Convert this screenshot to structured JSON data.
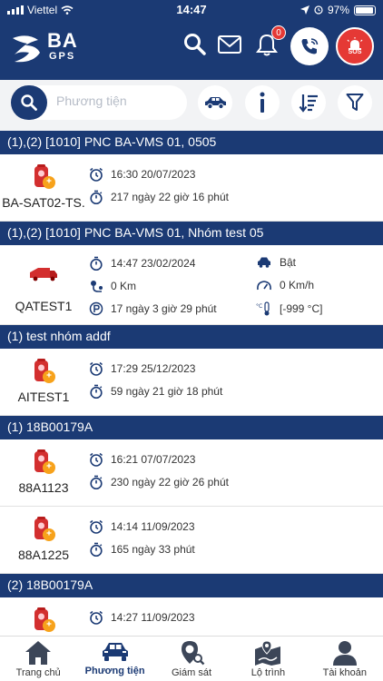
{
  "status_bar": {
    "carrier": "Viettel",
    "time": "14:47",
    "battery": "97%",
    "battery_fraction": 0.97
  },
  "header": {
    "logo_text": "BA",
    "logo_sub": "GPS",
    "notification_count": "0",
    "sos_label": "SOS"
  },
  "toolbar": {
    "search_placeholder": "Phương tiện"
  },
  "groups": [
    {
      "title": "(1),(2) [1010] PNC BA-VMS 01, 0505",
      "vehicles": [
        {
          "name": "BA-SAT02-TS.",
          "icon": "vehicle-red-light-icon",
          "time": "16:30 20/07/2023",
          "duration": "217 ngày 22 giờ 16 phút"
        }
      ]
    },
    {
      "title": "(1),(2) [1010] PNC BA-VMS 01, Nhóm test 05",
      "vehicles": [
        {
          "name": "QATEST1",
          "icon": "red-truck-icon",
          "time": "14:47 23/02/2024",
          "distance": "0 Km",
          "parking": "17 ngày 3 giờ 29 phút",
          "engine": "Bật",
          "speed": "0 Km/h",
          "temperature": "[-999 °C]"
        }
      ]
    },
    {
      "title": "(1) test nhóm addf",
      "vehicles": [
        {
          "name": "AITEST1",
          "icon": "vehicle-red-light-icon",
          "time": "17:29 25/12/2023",
          "duration": "59 ngày 21 giờ 18 phút"
        }
      ]
    },
    {
      "title": "(1) 18B00179A",
      "vehicles": [
        {
          "name": "88A1123",
          "icon": "vehicle-red-light-icon",
          "time": "16:21 07/07/2023",
          "duration": "230 ngày 22 giờ 26 phút"
        },
        {
          "name": "88A1225",
          "icon": "vehicle-red-light-icon",
          "time": "14:14 11/09/2023",
          "duration": "165 ngày 33 phút"
        }
      ]
    },
    {
      "title": "(2) 18B00179A",
      "vehicles": [
        {
          "name": "",
          "icon": "vehicle-red-light-icon",
          "time": "14:27 11/09/2023",
          "duration": ""
        }
      ]
    }
  ],
  "bottom_nav": [
    {
      "label": "Trang chủ",
      "icon": "home-icon"
    },
    {
      "label": "Phương tiện",
      "icon": "car-icon",
      "active": true
    },
    {
      "label": "Giám sát",
      "icon": "map-pin-search-icon"
    },
    {
      "label": "Lộ trình",
      "icon": "route-map-icon"
    },
    {
      "label": "Tài khoản",
      "icon": "account-icon"
    }
  ],
  "colors": {
    "primary": "#1b3a74",
    "accent": "#e53935",
    "vehicle_icon": "#d32f2f",
    "vehicle_light": "#f7a21b"
  }
}
